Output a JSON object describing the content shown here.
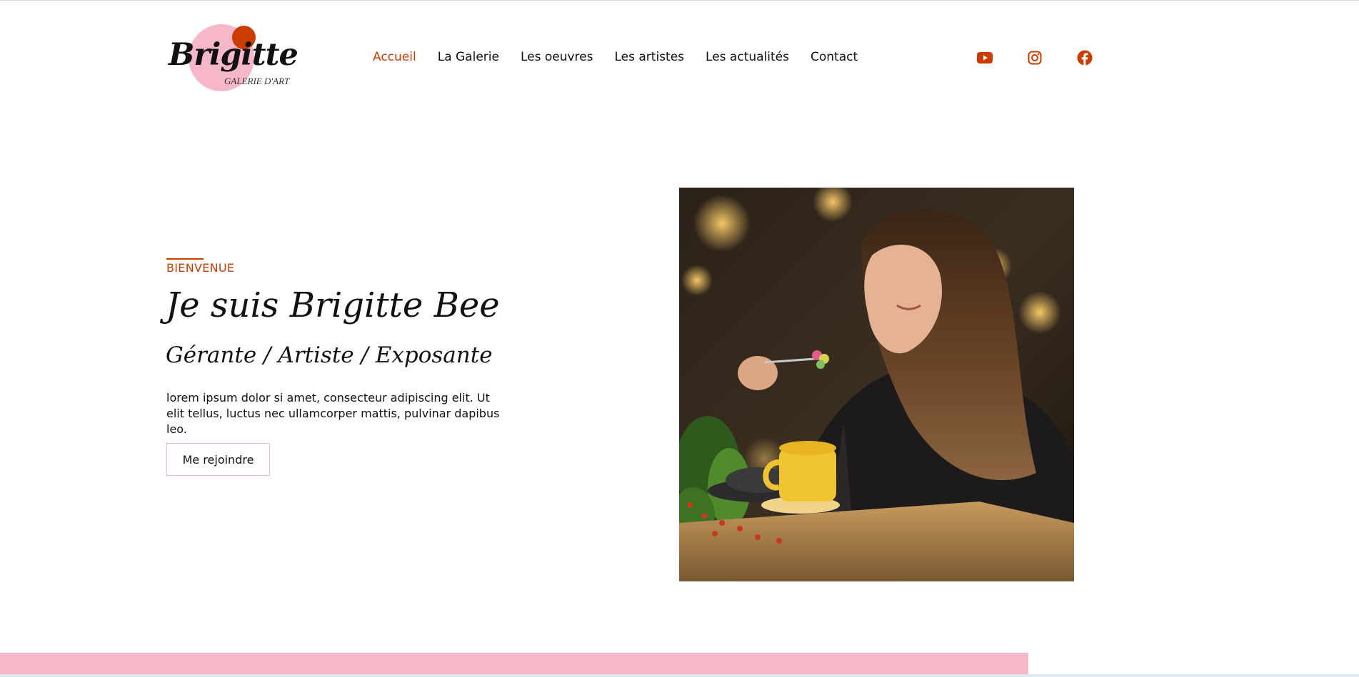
{
  "logo": {
    "name": "Brigitte",
    "subtitle": "GALERIE D'ART"
  },
  "nav": {
    "items": [
      {
        "label": "Accueil",
        "active": true
      },
      {
        "label": "La Galerie",
        "active": false
      },
      {
        "label": "Les oeuvres",
        "active": false
      },
      {
        "label": "Les artistes",
        "active": false
      },
      {
        "label": "Les actualités",
        "active": false
      },
      {
        "label": "Contact",
        "active": false
      }
    ]
  },
  "social": {
    "icons": [
      "youtube-icon",
      "instagram-icon",
      "facebook-icon"
    ],
    "color": "#cc3b00"
  },
  "hero": {
    "eyebrow": "BIENVENUE",
    "title": "Je suis Brigitte Bee",
    "subtitle": "Gérante / Artiste / Exposante",
    "description": "lorem ipsum dolor si amet, consecteur adipiscing elit. Ut elit tellus, luctus nec ullamcorper mattis, pulvinar dapibus leo.",
    "button": "Me rejoindre"
  },
  "colors": {
    "accent": "#cc3b00",
    "pink": "#f6b7c9",
    "text": "#111111"
  }
}
